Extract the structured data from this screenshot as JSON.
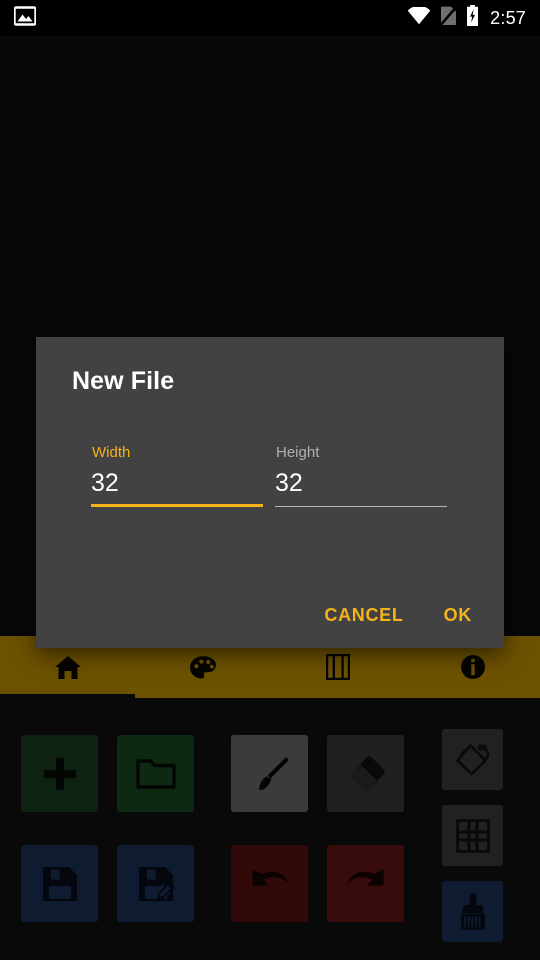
{
  "status_bar": {
    "left_icon": "image-icon",
    "wifi_icon": "wifi-icon",
    "sim_icon": "no-sim-icon",
    "battery_icon": "battery-charging-icon",
    "time": "2:57"
  },
  "tabs": [
    {
      "name": "tab-home",
      "icon": "home-icon",
      "selected": true
    },
    {
      "name": "tab-palette",
      "icon": "palette-icon",
      "selected": false
    },
    {
      "name": "tab-frames",
      "icon": "film-icon",
      "selected": false
    },
    {
      "name": "tab-info",
      "icon": "info-icon",
      "selected": false
    }
  ],
  "dialog": {
    "title": "New File",
    "width_field": {
      "label": "Width",
      "value": "32",
      "focused": true
    },
    "height_field": {
      "label": "Height",
      "value": "32",
      "focused": false
    },
    "cancel_label": "CANCEL",
    "ok_label": "OK"
  },
  "toolbar": {
    "buttons": [
      {
        "name": "new-file-button",
        "icon": "plus-icon",
        "color": "#1d4d24"
      },
      {
        "name": "open-file-button",
        "icon": "folder-icon",
        "color": "#1d5c26"
      },
      {
        "name": "brush-tool-button",
        "icon": "paintbrush-icon",
        "color": "#848484"
      },
      {
        "name": "eraser-tool-button",
        "icon": "eraser-icon",
        "color": "#484848"
      },
      {
        "name": "save-button",
        "icon": "floppy-icon",
        "color": "#1f3c6b"
      },
      {
        "name": "save-as-button",
        "icon": "floppy-edit-icon",
        "color": "#1f3c6b"
      },
      {
        "name": "undo-button",
        "icon": "undo-icon",
        "color": "#6d1616"
      },
      {
        "name": "redo-button",
        "icon": "redo-icon",
        "color": "#7c1a1a"
      },
      {
        "name": "fill-tool-button",
        "icon": "paint-bucket-icon",
        "color": "#4b4b4b"
      },
      {
        "name": "grid-toggle-button",
        "icon": "grid-icon",
        "color": "#4b4b4b"
      },
      {
        "name": "wide-brush-button",
        "icon": "wide-brush-icon",
        "color": "#1f3c6b"
      }
    ]
  },
  "colors": {
    "accent": "#f5b31b",
    "tab_bar": "#f0b400",
    "dialog_bg": "#424242",
    "app_bg": "#111111",
    "canvas_bg": "#101010"
  }
}
